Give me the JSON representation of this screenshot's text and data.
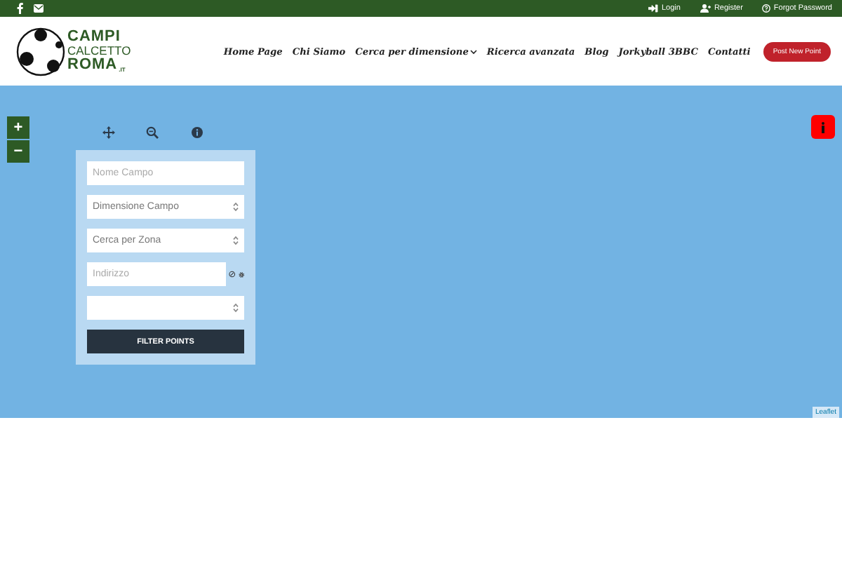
{
  "top_bar": {
    "links": [
      {
        "label": "Login",
        "kind": "login"
      },
      {
        "label": "Register",
        "kind": "register"
      },
      {
        "label": "Forgot Password",
        "kind": "help"
      }
    ]
  },
  "logo": {
    "lines": [
      "CAMPI",
      "CALCETTO",
      "ROMA"
    ],
    "suffix": ".IT"
  },
  "nav": {
    "items": [
      {
        "label": "Home Page",
        "dropdown": false
      },
      {
        "label": "Chi Siamo",
        "dropdown": false
      },
      {
        "label": "Cerca per dimensione",
        "dropdown": true
      },
      {
        "label": "Ricerca avanzata",
        "dropdown": false
      },
      {
        "label": "Blog",
        "dropdown": false
      },
      {
        "label": "Jorkyball 3BBC",
        "dropdown": false
      },
      {
        "label": "Contatti",
        "dropdown": false
      }
    ],
    "button": "Post New Point"
  },
  "map": {
    "zoom": [
      "+",
      "−"
    ],
    "filter": {
      "fields": [
        {
          "kind": "input",
          "placeholder": "Nome Campo"
        },
        {
          "kind": "select",
          "value": "Dimensione Campo"
        },
        {
          "kind": "select",
          "value": "Cerca per Zona"
        },
        {
          "kind": "address",
          "placeholder": "Indirizzo"
        },
        {
          "kind": "select"
        }
      ],
      "button": "FILTER POINTS"
    },
    "attribution": "Leaflet"
  }
}
